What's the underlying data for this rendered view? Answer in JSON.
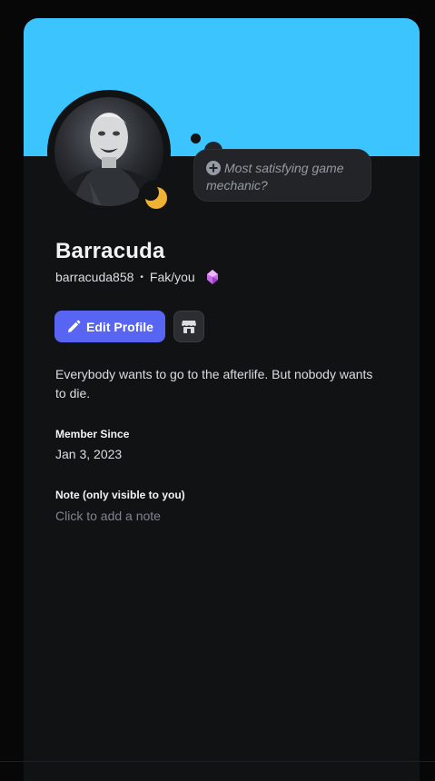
{
  "profile": {
    "display_name": "Barracuda",
    "username": "barracuda858",
    "separator": "•",
    "pronouns": "Fak/you",
    "status_prompt": "Most satisfying game mechanic?",
    "bio": "Everybody wants to go to the afterlife. But nobody wants to die.",
    "status": "idle"
  },
  "actions": {
    "edit_label": "Edit Profile"
  },
  "sections": {
    "member_since_title": "Member Since",
    "member_since_value": "Jan 3, 2023",
    "note_title": "Note (only visible to you)",
    "note_placeholder": "Click to add a note"
  },
  "colors": {
    "banner": "#3cc4ff",
    "accent": "#5865f2",
    "idle": "#f0b232",
    "card": "#111214"
  },
  "icons": [
    "plus-circle-icon",
    "gem-badge-icon",
    "pencil-icon",
    "shop-icon",
    "moon-icon"
  ]
}
